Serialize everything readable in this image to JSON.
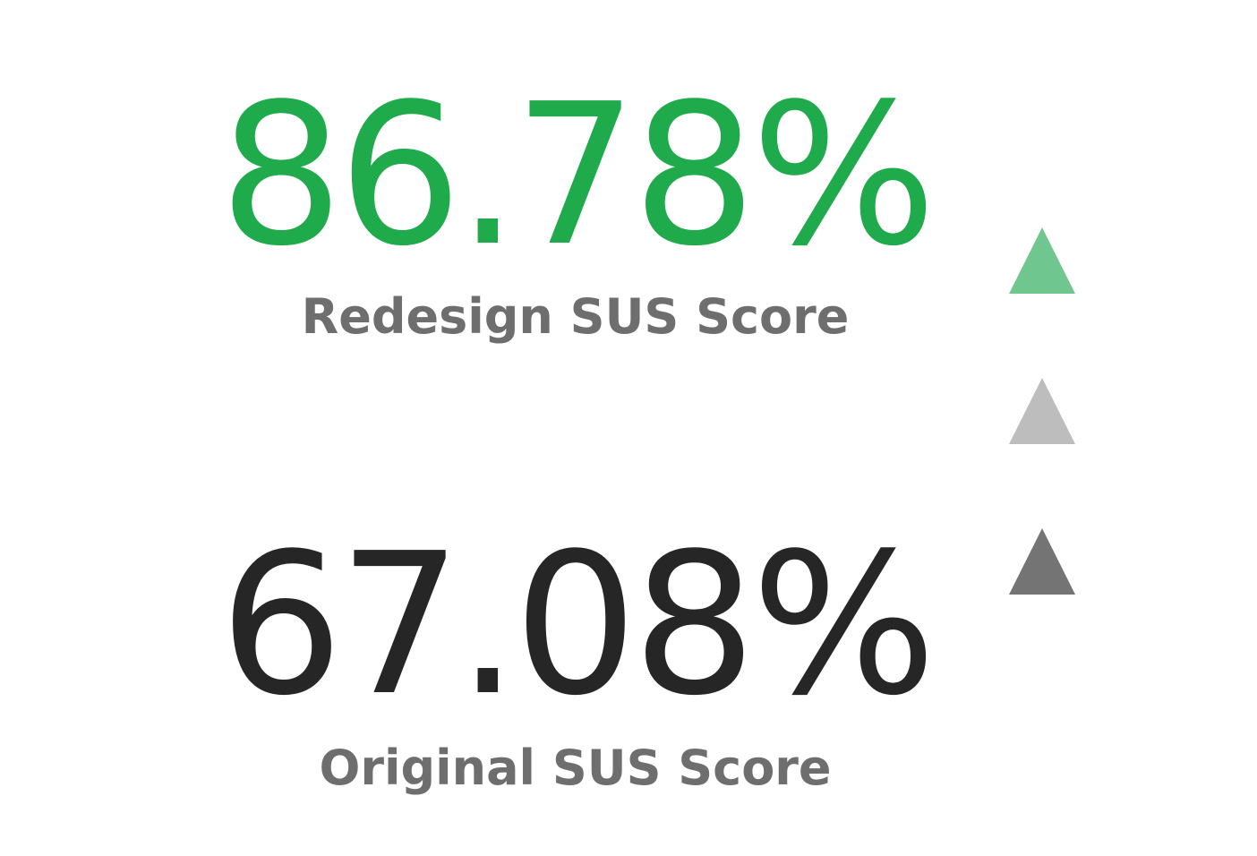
{
  "redesign": {
    "value": "86.78%",
    "label": "Redesign SUS Score",
    "color": "#1faa4b"
  },
  "original": {
    "value": "67.08%",
    "label": "Original SUS Score",
    "color": "#262626"
  },
  "label_color": "#6e6e6e",
  "indicators": [
    {
      "icon": "triangle-up-icon",
      "color": "#6fc78f"
    },
    {
      "icon": "triangle-up-icon",
      "color": "#bdbdbd"
    },
    {
      "icon": "triangle-up-icon",
      "color": "#747474"
    }
  ]
}
